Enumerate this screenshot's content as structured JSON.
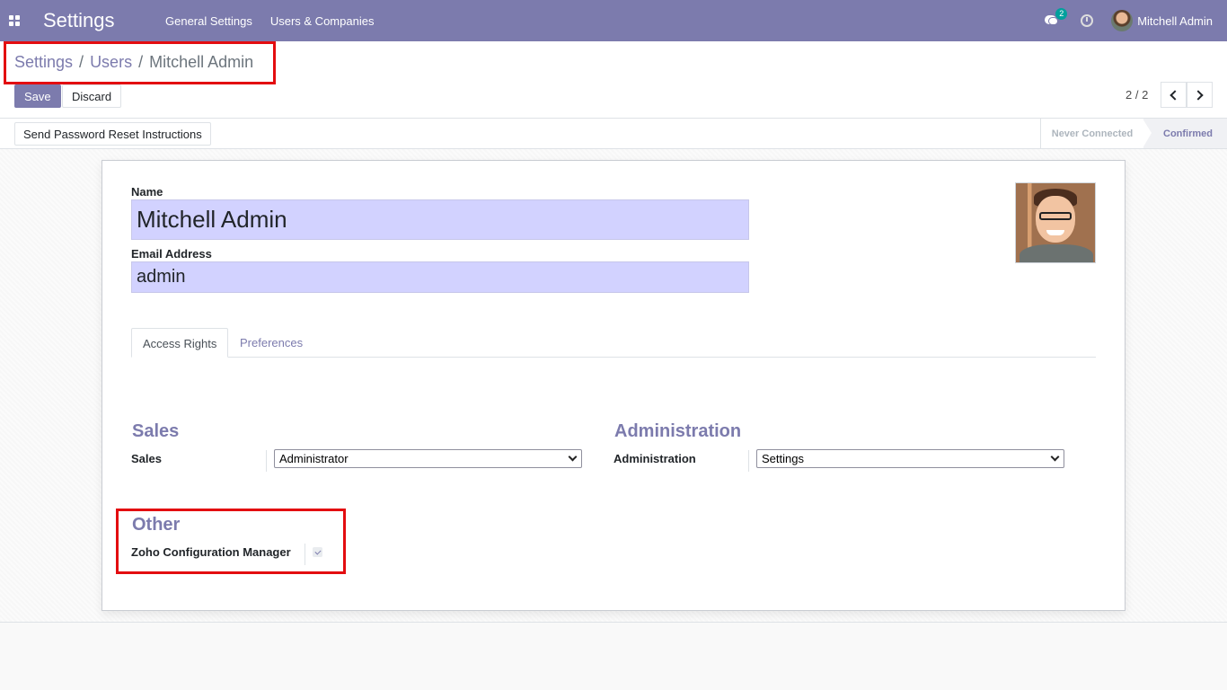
{
  "navbar": {
    "app_title": "Settings",
    "menu": [
      "General Settings",
      "Users & Companies"
    ],
    "message_count": "2",
    "user_name": "Mitchell Admin"
  },
  "breadcrumb": {
    "items": [
      "Settings",
      "Users"
    ],
    "separator": "/",
    "current": "Mitchell Admin"
  },
  "actions": {
    "save_label": "Save",
    "discard_label": "Discard"
  },
  "pager": {
    "value": "2 / 2"
  },
  "statusbar": {
    "reset_button_label": "Send Password Reset Instructions",
    "stages": [
      "Never Connected",
      "Confirmed"
    ],
    "active_stage": "Confirmed"
  },
  "form": {
    "name_label": "Name",
    "name_value": "Mitchell Admin",
    "email_label": "Email Address",
    "email_value": "admin",
    "tabs": [
      "Access Rights",
      "Preferences"
    ],
    "active_tab": "Access Rights",
    "groups": {
      "sales": {
        "title": "Sales",
        "field_label": "Sales",
        "value": "Administrator"
      },
      "administration": {
        "title": "Administration",
        "field_label": "Administration",
        "value": "Settings"
      },
      "other": {
        "title": "Other",
        "field_label": "Zoho Configuration Manager",
        "checked": true
      }
    }
  },
  "colors": {
    "brand": "#7c7bad",
    "highlight": "#e30d10",
    "input_bg": "#d2d2ff"
  }
}
